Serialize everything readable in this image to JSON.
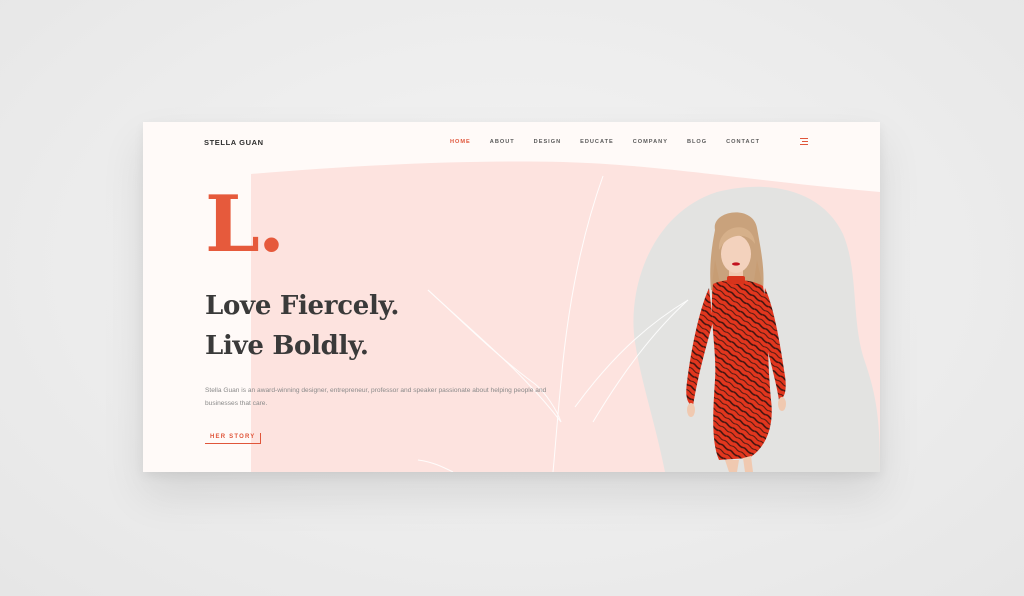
{
  "site": {
    "brand": "STELLA GUAN"
  },
  "nav": {
    "items": [
      {
        "label": "HOME",
        "active": true
      },
      {
        "label": "ABOUT",
        "active": false
      },
      {
        "label": "DESIGN",
        "active": false
      },
      {
        "label": "EDUCATE",
        "active": false
      },
      {
        "label": "COMPANY",
        "active": false
      },
      {
        "label": "BLOG",
        "active": false
      },
      {
        "label": "CONTACT",
        "active": false
      }
    ],
    "menu_icon": "hamburger-menu-icon"
  },
  "hero": {
    "letter": "L.",
    "headline_line1": "Love Fiercely.",
    "headline_line2": "Live Boldly.",
    "description": "Stella Guan is an award-winning designer, entrepreneur, professor and speaker passionate about helping people and businesses that care.",
    "cta_label": "HER STORY",
    "photo": "woman-in-red-zebra-print-dress-photo"
  },
  "colors": {
    "accent": "#e0553a",
    "pink_block": "#fde3df",
    "page_bg": "#fffaf8",
    "photo_bg": "#e3e3e1",
    "text_dark": "#3a3a3a"
  }
}
